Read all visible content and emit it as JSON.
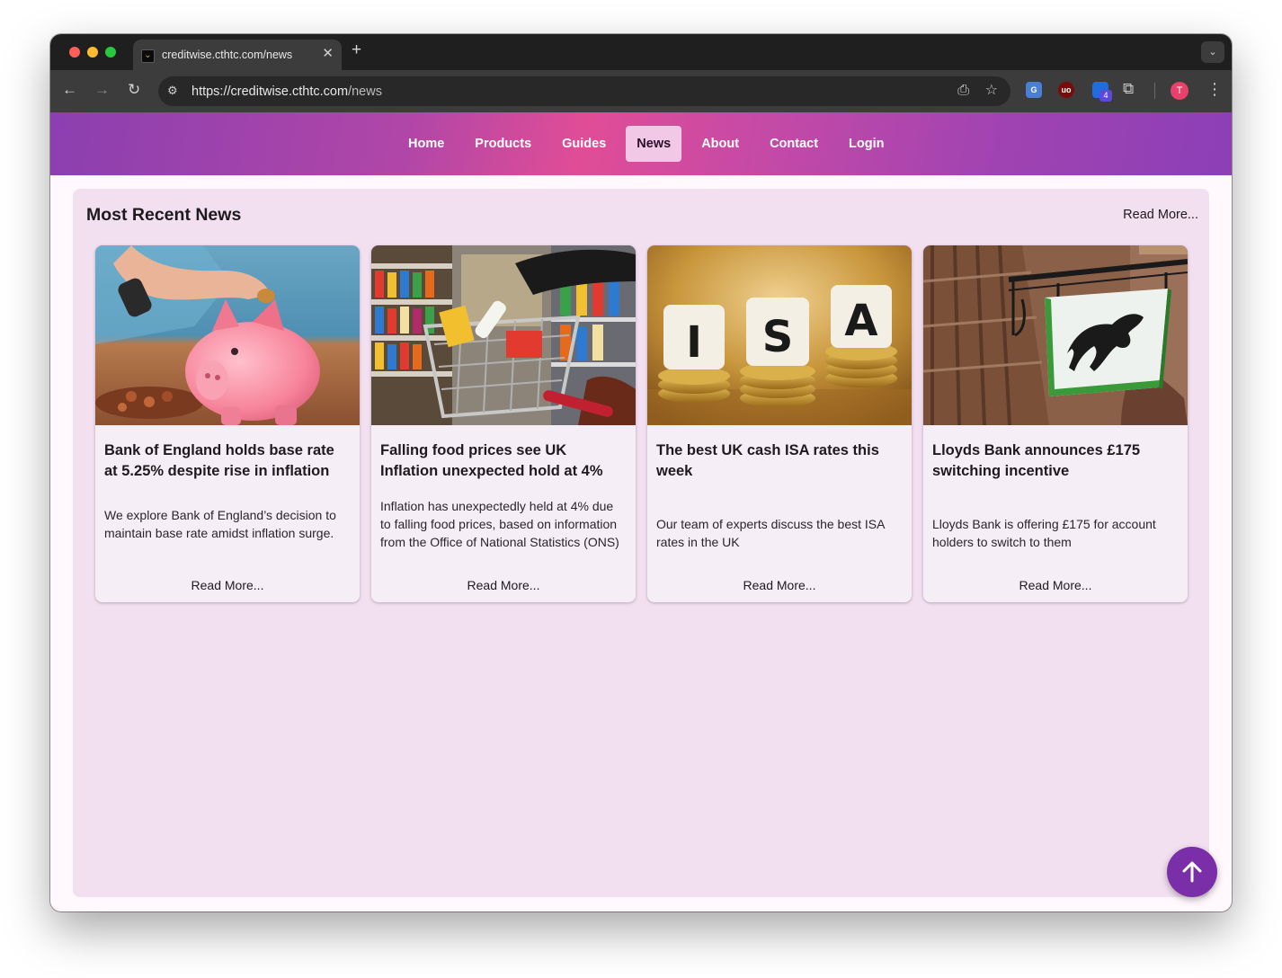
{
  "browser": {
    "tab_title": "creditwise.cthtc.com/news",
    "tab_close": "✕",
    "new_tab": "+",
    "url_host": "https://creditwise.cthtc.com",
    "url_path": "/news",
    "extension_badge": "4",
    "profile_initial": "T"
  },
  "nav": {
    "links": [
      "Home",
      "Products",
      "Guides",
      "News",
      "About",
      "Contact",
      "Login"
    ],
    "active": "News"
  },
  "news": {
    "heading": "Most Recent News",
    "read_more": "Read More...",
    "cards": [
      {
        "image": "piggy-bank-coin",
        "title": "Bank of England holds base rate at 5.25% despite rise in inflation",
        "description": "We explore Bank of England’s decision to maintain base rate amidst inflation surge.",
        "read_more": "Read More..."
      },
      {
        "image": "supermarket-trolley",
        "title": "Falling food prices see UK Inflation unexpected hold at 4%",
        "description": "Inflation has unexpectedly held at 4% due to falling food prices, based on information from the Office of National Statistics (ONS)",
        "read_more": "Read More..."
      },
      {
        "image": "isa-letter-tiles-on-coins",
        "title": "The best UK cash ISA rates this week",
        "description": "Our team of experts discuss the best ISA rates in the UK",
        "read_more": "Read More..."
      },
      {
        "image": "lloyds-bank-sign",
        "title": "Lloyds Bank announces £175 switching incentive",
        "description": "Lloyds Bank is offering £175 for account holders to switch to them",
        "read_more": "Read More..."
      }
    ]
  },
  "isa_letters": [
    "I",
    "S",
    "A"
  ],
  "icons": {
    "back": "back-arrow-icon",
    "forward": "forward-arrow-icon",
    "reload": "reload-icon",
    "scroll_top": "arrow-up-icon"
  },
  "colors": {
    "nav_gradient_pink": "#e04d96",
    "nav_gradient_purple": "#8b3fb0",
    "panel_bg": "#f2dff0",
    "active_tab_bg": "#f1c8e6",
    "fab": "#7a2fa8"
  }
}
